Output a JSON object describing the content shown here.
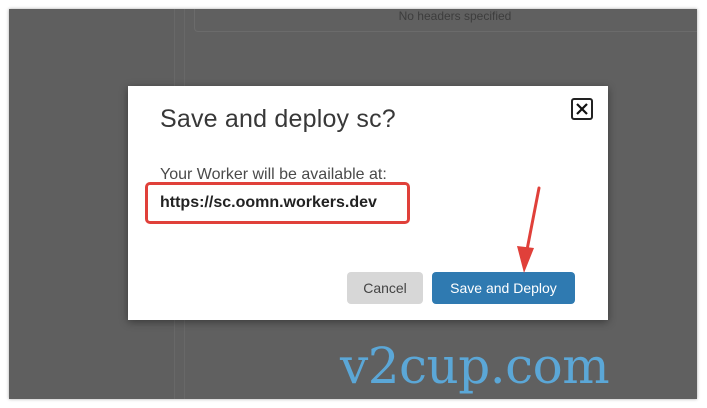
{
  "background": {
    "headers_text": "No headers specified"
  },
  "dialog": {
    "title": "Save and deploy sc?",
    "available_label": "Your Worker will be available at:",
    "url": "https://sc.oomn.workers.dev",
    "cancel_label": "Cancel",
    "deploy_label": "Save and Deploy",
    "close_icon": "close-icon"
  },
  "annotation": {
    "highlight_color": "#e0403a",
    "arrow_icon": "arrow-down-icon"
  },
  "watermark": {
    "text": "v2cup.com",
    "color": "#5ba7d7"
  },
  "colors": {
    "overlay": "#5f5f5f",
    "primary_button": "#2f7ab1",
    "secondary_button": "#d7d7d7"
  }
}
